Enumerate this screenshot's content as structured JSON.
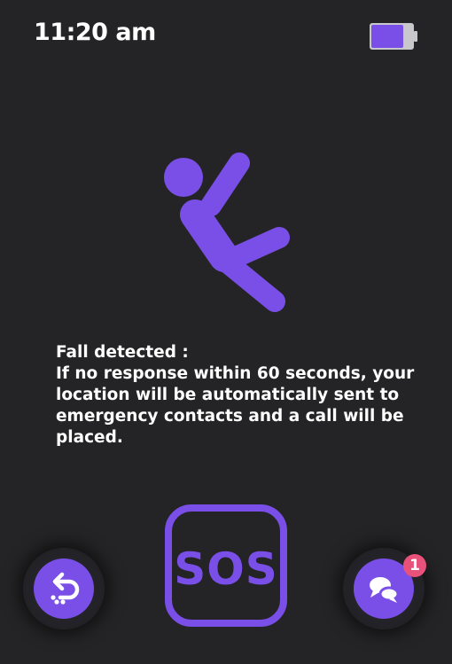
{
  "status_bar": {
    "time": "11:20 am",
    "battery_icon": "battery-icon",
    "battery_level": 0.75
  },
  "illustration": {
    "icon": "fall-person-icon"
  },
  "alert": {
    "title": "Fall detected :",
    "body": "If no response within 60 seconds, your location will be automatically sent to emergency contacts and a call will be placed."
  },
  "sos": {
    "label": "SOS",
    "icon": "sos-icon"
  },
  "actions": {
    "back_icon": "undo-icon",
    "chat_icon": "chat-icon",
    "chat_badge": "1"
  },
  "colors": {
    "background": "#242426",
    "accent": "#7a4fe8",
    "badge": "#e8527a",
    "text": "#ffffff"
  }
}
